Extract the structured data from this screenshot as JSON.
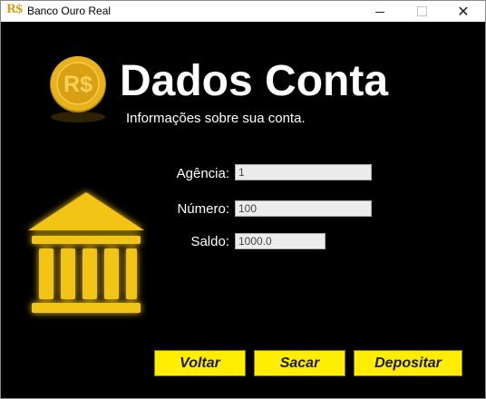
{
  "window": {
    "title": "Banco Ouro Real",
    "app_icon_text": "R$"
  },
  "header": {
    "title": "Dados Conta",
    "subtitle": "Informações sobre sua conta.",
    "coin_symbol": "R$"
  },
  "form": {
    "agencia": {
      "label": "Agência:",
      "value": "1"
    },
    "numero": {
      "label": "Número:",
      "value": "100"
    },
    "saldo": {
      "label": "Saldo:",
      "value": "1000.0"
    }
  },
  "buttons": {
    "voltar": "Voltar",
    "sacar": "Sacar",
    "depositar": "Depositar"
  },
  "colors": {
    "background": "#000000",
    "gold": "#f2c419",
    "button": "#ffee00"
  }
}
